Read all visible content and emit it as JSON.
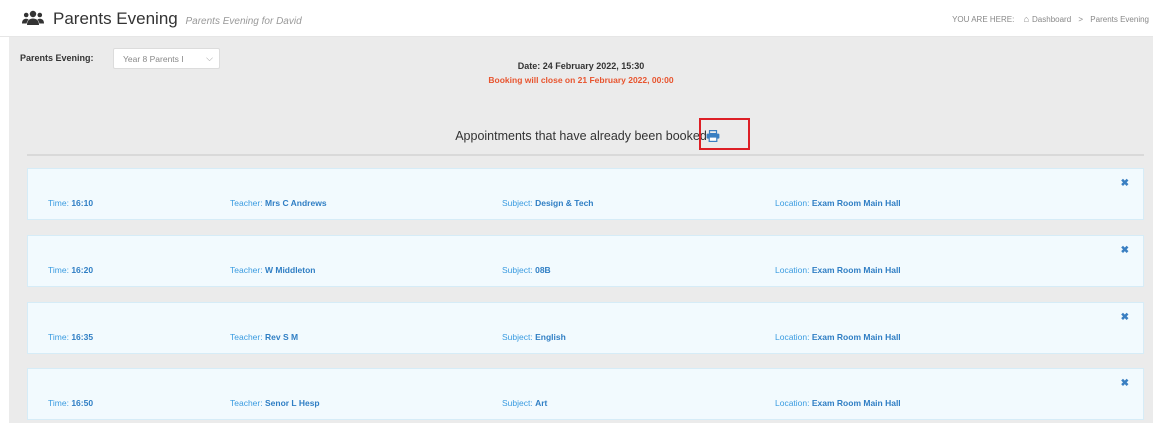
{
  "header": {
    "title": "Parents Evening",
    "subtitle": "Parents Evening for David",
    "breadcrumb_label": "YOU ARE HERE:",
    "breadcrumb": [
      "Dashboard",
      "Parents Evening"
    ],
    "icons": {
      "title": "users-icon",
      "home": "home-icon"
    }
  },
  "filter": {
    "label": "Parents Evening:",
    "selected": "Year 8 Parents I"
  },
  "event": {
    "date": "Date: 24 February 2022, 15:30",
    "closing": "Booking will close on 21 February 2022, 00:00"
  },
  "booked": {
    "heading": "Appointments that have already been booked",
    "print_icon": "printer-icon"
  },
  "labels": {
    "time": "Time:",
    "teacher": "Teacher:",
    "subject": "Subject:",
    "location": "Location:",
    "remove": "✖"
  },
  "appointments": [
    {
      "time": "16:10",
      "teacher": "Mrs C Andrews",
      "subject": "Design & Tech",
      "location": "Exam Room Main Hall"
    },
    {
      "time": "16:20",
      "teacher": "W Middleton",
      "subject": "08B",
      "location": "Exam Room Main Hall"
    },
    {
      "time": "16:35",
      "teacher": "Rev S M",
      "subject": "English",
      "location": "Exam Room Main Hall"
    },
    {
      "time": "16:50",
      "teacher": "Senor L Hesp",
      "subject": "Art",
      "location": "Exam Room Main Hall"
    }
  ],
  "colors": {
    "accent": "#2f7ec4",
    "warning": "#e8542e",
    "highlight_box": "#dd1f26"
  }
}
